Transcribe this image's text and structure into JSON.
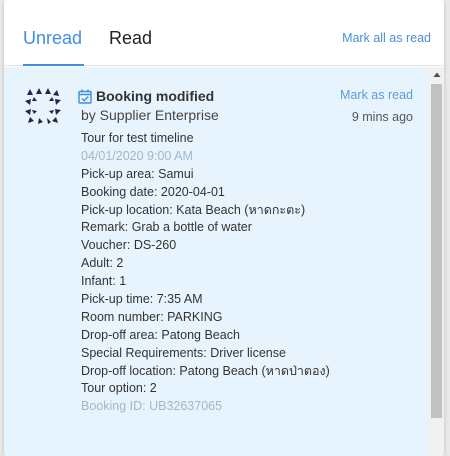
{
  "tabs": [
    {
      "label": "Unread",
      "active": true
    },
    {
      "label": "Read",
      "active": false
    }
  ],
  "header": {
    "mark_all_label": "Mark all as read"
  },
  "colors": {
    "accent": "#3d8fe0",
    "unread_bg": "#e8f4fd",
    "link": "#4a8fd3"
  },
  "notification": {
    "icon": "calendar-check-icon",
    "title": "Booking modified",
    "by": "by Supplier Enterprise",
    "mark_read_label": "Mark as read",
    "time_ago": "9 mins ago",
    "lines": [
      "Tour for test timeline",
      "04/01/2020 9:00 AM",
      "Pick-up area: Samui",
      "Booking date: 2020-04-01",
      "Pick-up location: Kata Beach (หาดกะตะ)",
      "Remark: Grab a bottle of water",
      "Voucher: DS-260",
      "Adult: 2",
      "Infant: 1",
      "Pick-up time: 7:35 AM",
      "Room number: PARKING",
      "Drop-off area: Patong Beach",
      "Special Requirements: Driver license",
      "Drop-off location: Patong Beach (หาดป่าตอง)",
      "Tour option: 2",
      "Booking ID: UB32637065"
    ]
  }
}
